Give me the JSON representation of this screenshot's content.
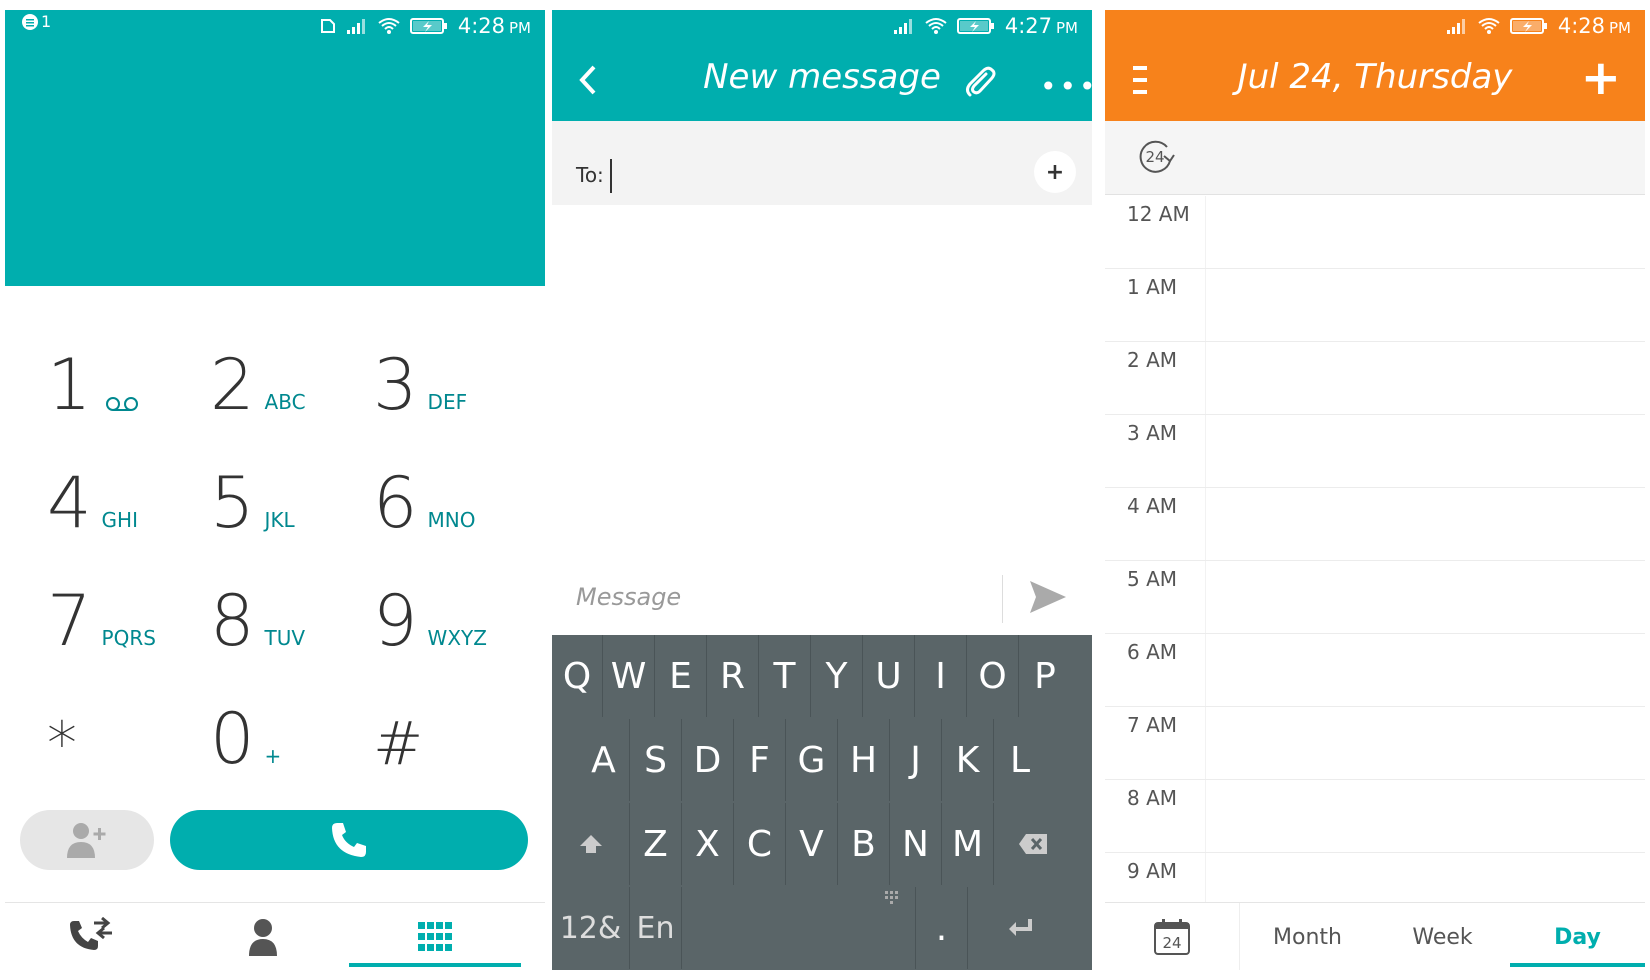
{
  "dialer": {
    "status": {
      "notification_count": "1",
      "time": "4:28",
      "ampm": "PM"
    },
    "keys": [
      {
        "digit": "1",
        "letters": ""
      },
      {
        "digit": "2",
        "letters": "ABC"
      },
      {
        "digit": "3",
        "letters": "DEF"
      },
      {
        "digit": "4",
        "letters": "GHI"
      },
      {
        "digit": "5",
        "letters": "JKL"
      },
      {
        "digit": "6",
        "letters": "MNO"
      },
      {
        "digit": "7",
        "letters": "PQRS"
      },
      {
        "digit": "8",
        "letters": "TUV"
      },
      {
        "digit": "9",
        "letters": "WXYZ"
      },
      {
        "digit": "*",
        "letters": ""
      },
      {
        "digit": "0",
        "letters": "+"
      },
      {
        "digit": "#",
        "letters": ""
      }
    ],
    "tabs": [
      "call-log-icon",
      "contacts-icon",
      "keypad-icon"
    ],
    "active_tab": "keypad",
    "accent": "#00aeae"
  },
  "messages": {
    "status": {
      "time": "4:27",
      "ampm": "PM"
    },
    "title": "New message",
    "to_label": "To:",
    "message_placeholder": "Message",
    "keyboard": {
      "row1": [
        "Q",
        "W",
        "E",
        "R",
        "T",
        "Y",
        "U",
        "I",
        "O",
        "P"
      ],
      "row2": [
        "A",
        "S",
        "D",
        "F",
        "G",
        "H",
        "J",
        "K",
        "L"
      ],
      "row3": [
        "Z",
        "X",
        "C",
        "V",
        "B",
        "N",
        "M"
      ],
      "symbols_key": "12&",
      "lang_key": "En",
      "period_key": "."
    },
    "accent": "#00aeae"
  },
  "calendar": {
    "status": {
      "time": "4:28",
      "ampm": "PM"
    },
    "title": "Jul 24, Thursday",
    "hours": [
      "12 AM",
      "1 AM",
      "2 AM",
      "3 AM",
      "4 AM",
      "5 AM",
      "6 AM",
      "7 AM",
      "8 AM",
      "9 AM"
    ],
    "today_icon_number": "24",
    "tabs": {
      "month": "Month",
      "week": "Week",
      "day": "Day"
    },
    "active_tab": "Day",
    "accent": "#f7821b"
  }
}
